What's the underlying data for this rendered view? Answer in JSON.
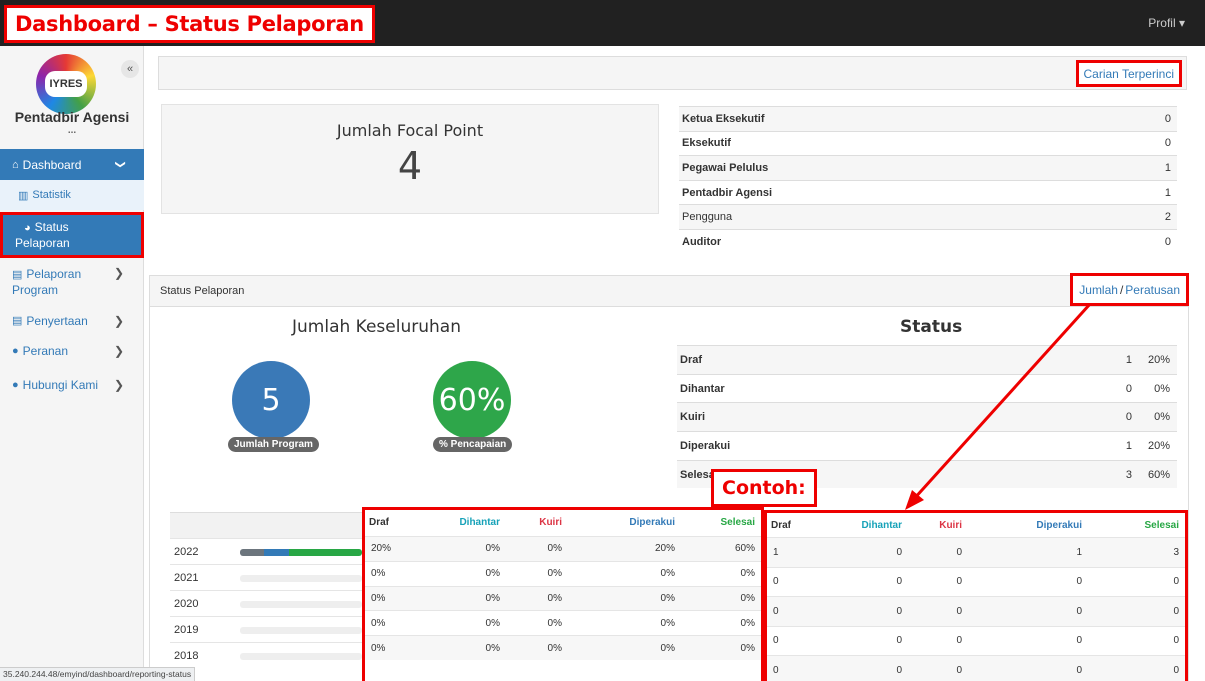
{
  "annotation": {
    "title": "Dashboard – Status Pelaporan",
    "example_label": "Contoh:"
  },
  "topbar": {
    "profile_label": "Profil ▾"
  },
  "sidebar": {
    "logo_text": "IYRES",
    "collapse_glyph": "«",
    "user_name": "Pentadbir Agensi",
    "user_name_more": "...",
    "items": [
      {
        "icon": "⌂",
        "label": "Dashboard",
        "chevron": "❯"
      },
      {
        "icon": "▥",
        "label": "Statistik"
      },
      {
        "icon": "◕",
        "label": "Status",
        "label2": "Pelaporan"
      },
      {
        "icon": "▤",
        "label": "Pelaporan",
        "label2": "Program",
        "chevron": "❯"
      },
      {
        "icon": "▤",
        "label": "Penyertaan",
        "chevron": "❯"
      },
      {
        "icon": "●",
        "label": "Peranan",
        "chevron": "❯"
      },
      {
        "icon": "●",
        "label": "Hubungi Kami",
        "chevron": "❯"
      }
    ]
  },
  "search": {
    "advanced_label": "Carian Terperinci"
  },
  "focal": {
    "label": "Jumlah Focal Point",
    "value": "4"
  },
  "roles": [
    {
      "name": "Ketua Eksekutif",
      "count": "0"
    },
    {
      "name": "Eksekutif",
      "count": "0"
    },
    {
      "name": "Pegawai Pelulus",
      "count": "1"
    },
    {
      "name": "Pentadbir Agensi",
      "count": "1"
    },
    {
      "name": "Pengguna",
      "count": "2"
    },
    {
      "name": "Auditor",
      "count": "0"
    }
  ],
  "status_panel": {
    "title": "Status Pelaporan",
    "toggle_count": "Jumlah",
    "toggle_sep": "/",
    "toggle_percent": "Peratusan",
    "overall_title": "Jumlah Keseluruhan",
    "total_programs": "5",
    "total_programs_label": "Jumlah Program",
    "achievement": "60%",
    "achievement_label": "% Pencapaian",
    "status_title": "Status",
    "status_rows": [
      {
        "name": "Draf",
        "count": "1",
        "pct": "20%"
      },
      {
        "name": "Dihantar",
        "count": "0",
        "pct": "0%"
      },
      {
        "name": "Kuiri",
        "count": "0",
        "pct": "0%"
      },
      {
        "name": "Diperakui",
        "count": "1",
        "pct": "20%"
      },
      {
        "name": "Selesai",
        "count": "3",
        "pct": "60%"
      }
    ]
  },
  "yearly": {
    "columns": [
      "Draf",
      "Dihantar",
      "Kuiri",
      "Diperakui",
      "Selesai"
    ],
    "column_colors": [
      "#333333",
      "#17a2b8",
      "#dc3545",
      "#337ab7",
      "#28a745"
    ],
    "segment_colors": [
      "#6c757d",
      "#17a2b8",
      "#dc3545",
      "#337ab7",
      "#28a745"
    ],
    "rows": [
      {
        "year": "2022",
        "pct": [
          "20%",
          "0%",
          "0%",
          "20%",
          "60%"
        ],
        "count": [
          "1",
          "0",
          "0",
          "1",
          "3"
        ],
        "bar": [
          0.2,
          0,
          0,
          0.2,
          0.6
        ]
      },
      {
        "year": "2021",
        "pct": [
          "0%",
          "0%",
          "0%",
          "0%",
          "0%"
        ],
        "count": [
          "0",
          "0",
          "0",
          "0",
          "0"
        ],
        "bar": [
          0,
          0,
          0,
          0,
          0
        ]
      },
      {
        "year": "2020",
        "pct": [
          "0%",
          "0%",
          "0%",
          "0%",
          "0%"
        ],
        "count": [
          "0",
          "0",
          "0",
          "0",
          "0"
        ],
        "bar": [
          0,
          0,
          0,
          0,
          0
        ]
      },
      {
        "year": "2019",
        "pct": [
          "0%",
          "0%",
          "0%",
          "0%",
          "0%"
        ],
        "count": [
          "0",
          "0",
          "0",
          "0",
          "0"
        ],
        "bar": [
          0,
          0,
          0,
          0,
          0
        ]
      },
      {
        "year": "2018",
        "pct": [
          "0%",
          "0%",
          "0%",
          "0%",
          "0%"
        ],
        "count": [
          "0",
          "0",
          "0",
          "0",
          "0"
        ],
        "bar": [
          0,
          0,
          0,
          0,
          0
        ]
      }
    ]
  },
  "status_url": "35.240.244.48/emyind/dashboard/reporting-status"
}
